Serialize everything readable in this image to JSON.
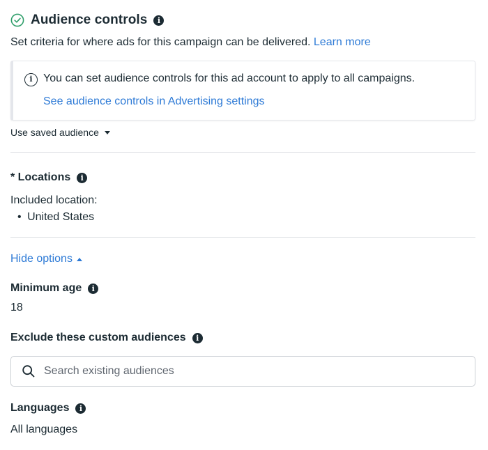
{
  "header": {
    "title": "Audience controls",
    "description": "Set criteria for where ads for this campaign can be delivered.",
    "learn_more": "Learn more"
  },
  "notice": {
    "text": "You can set audience controls for this ad account to apply to all campaigns.",
    "link": "See audience controls in Advertising settings"
  },
  "saved_audience": {
    "label": "Use saved audience"
  },
  "locations": {
    "title": "* Locations",
    "included_label": "Included location:",
    "items": [
      "United States"
    ]
  },
  "options_toggle": {
    "label": "Hide options"
  },
  "minimum_age": {
    "title": "Minimum age",
    "value": "18"
  },
  "exclude_audiences": {
    "title": "Exclude these custom audiences",
    "placeholder": "Search existing audiences"
  },
  "languages": {
    "title": "Languages",
    "value": "All languages"
  },
  "colors": {
    "link": "#2d7ad6",
    "text": "#1c2b33",
    "success": "#2f9e6a",
    "divider": "#dadde1"
  }
}
